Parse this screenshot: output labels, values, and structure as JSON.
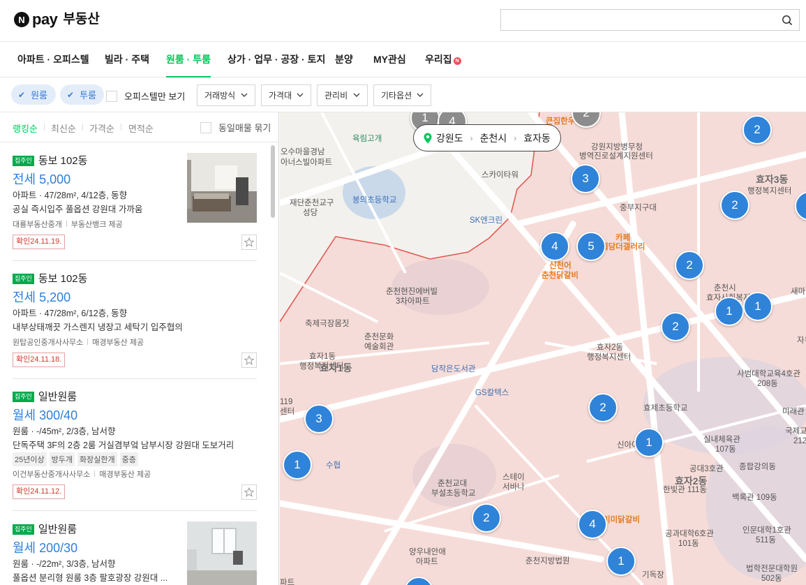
{
  "header": {
    "logo_n": "N",
    "logo_pay": "pay",
    "logo_title": "부동산",
    "search_placeholder": ""
  },
  "nav": {
    "items": [
      "아파트 · 오피스텔",
      "빌라 · 주택",
      "원룸 · 투룸",
      "상가 · 업무 · 공장 · 토지",
      "분양",
      "MY관심",
      "우리집"
    ],
    "active_index": 2,
    "badge": "N"
  },
  "filters": {
    "chip1": "원룸",
    "chip2": "투룸",
    "officetel_only": "오피스텔만 보기",
    "dropdowns": [
      "거래방식",
      "가격대",
      "관리비",
      "기타옵션"
    ]
  },
  "sort": {
    "items": [
      "랭킹순",
      "최신순",
      "가격순",
      "면적순"
    ],
    "active_index": 0,
    "group_label": "동일매물 묶기"
  },
  "listings": [
    {
      "tag": "집주인",
      "name": "동보 102동",
      "price": "전세 5,000",
      "spec": "아파트 · 47/28m², 4/12층, 동향",
      "desc": "공실 즉시입주 풀옵션 강원대 가까움",
      "tags": [],
      "agent": "대룡부동산중개",
      "provider": "부동산뱅크 제공",
      "date": "확인24.11.19.",
      "has_photo": true
    },
    {
      "tag": "집주인",
      "name": "동보 102동",
      "price": "전세 5,200",
      "spec": "아파트 · 47/28m², 6/12층, 동향",
      "desc": "내부상태깨끗 가스렌지 냉장고 세탁기 입주협의",
      "tags": [],
      "agent": "원탑공인중개사사무소",
      "provider": "매경부동산 제공",
      "date": "확인24.11.18.",
      "has_photo": false
    },
    {
      "tag": "집주인",
      "name": "일반원룸",
      "price": "월세 300/40",
      "spec": "원룸 · -/45m², 2/3층, 남서향",
      "desc": "단독주택 3F의 2층 2룸 거실겸부엌 남부시장 강원대 도보거리",
      "tags": [
        "25년이상",
        "방두개",
        "화장실한개",
        "중층"
      ],
      "agent": "이건부동산중개사사무소",
      "provider": "매경부동산 제공",
      "date": "확인24.11.12.",
      "has_photo": false
    },
    {
      "tag": "집주인",
      "name": "일반원룸",
      "price": "월세 200/30",
      "spec": "원룸 · -/22m², 3/3층, 남서향",
      "desc": "풀옵션 분리형 원룸 3층 팔호광장 강원대 ...",
      "tags": [],
      "agent": "",
      "provider": "",
      "date": "",
      "has_photo": true
    }
  ],
  "map": {
    "breadcrumb": [
      "강원도",
      "춘천시",
      "효자동"
    ],
    "clusters": [
      "1",
      "4",
      "2",
      "2",
      "3",
      "2",
      "1",
      "2",
      "4",
      "5",
      "2",
      "1",
      "1",
      "2",
      "2",
      "3",
      "1",
      "1",
      "2",
      "4",
      "1"
    ],
    "pois": [
      "큰집한우",
      "육림고개",
      "효자1동",
      "강원지방병무청",
      "병역진로설계지원센터",
      "효자3동",
      "행정복지센터",
      "오수마을경남",
      "아너스빌아파트",
      "스카이타워",
      "재단춘천교구",
      "성당",
      "봉의초등학교",
      "중부지구대",
      "SK엔크린",
      "카페",
      "예담더갤러리",
      "신천어",
      "춘천닭갈비",
      "춘천현진에버빌",
      "3차아파트",
      "춘천시",
      "효자사회복지",
      "새마",
      "축제극장몸짓",
      "춘천문화",
      "예술회관",
      "자유",
      "효자1동",
      "행정복지센터",
      "효자2동",
      "행정복지센터",
      "담작은도서관",
      "효자1동",
      "사범대학교육4호관",
      "208동",
      "GS칼텍스",
      "효제초등학교",
      "미래관",
      "국제교",
      "212",
      "119",
      "센터",
      "신아아파트",
      "실내체육관",
      "107동",
      "공대3호관",
      "종합강의동",
      "수협",
      "스테이",
      "서바나",
      "춘천교대",
      "부설초등학교",
      "효자2동",
      "한빛관 111동",
      "백록관 109동",
      "미미닭갈비",
      "공과대학6호관",
      "101동",
      "인문대학1호관",
      "511동",
      "양우내안애",
      "아파트",
      "춘천지방법원",
      "기독장",
      "법학전문대학원",
      "502동",
      "파트"
    ]
  }
}
